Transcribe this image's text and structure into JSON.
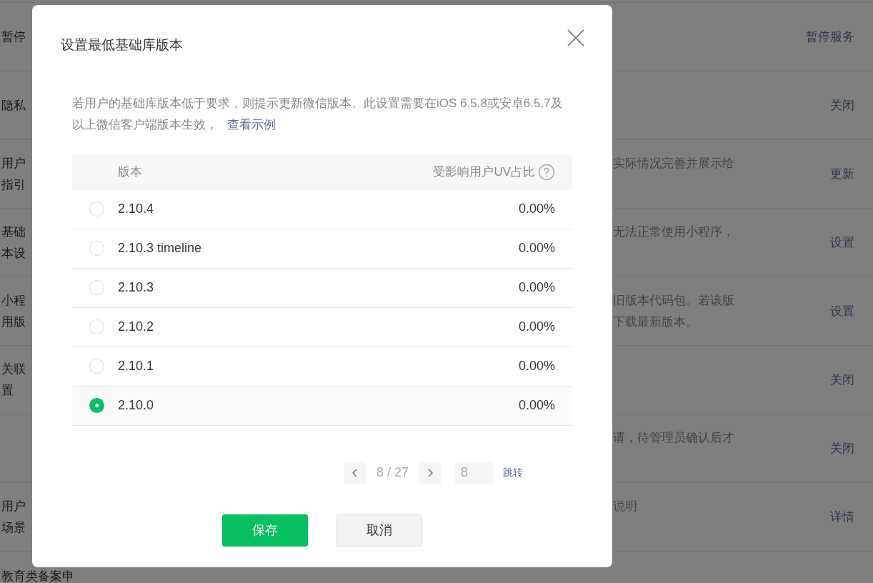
{
  "background_rows": [
    {
      "label": [
        "暂停"
      ],
      "description": [],
      "action": "暂停服务"
    },
    {
      "label": [
        "隐私"
      ],
      "description": [],
      "action": "关闭"
    },
    {
      "label": [
        "用户",
        "指引"
      ],
      "description": [
        "实际情况完善并展示给"
      ],
      "action": "更新"
    },
    {
      "label": [
        "基础",
        "本设"
      ],
      "description": [
        "无法正常使用小程序，"
      ],
      "action": "设置"
    },
    {
      "label": [
        "小程",
        "用版"
      ],
      "description": [
        "旧版本代码包。若该版",
        "下载最新版本。"
      ],
      "action": "设置"
    },
    {
      "label": [
        "关联",
        "置"
      ],
      "description": [],
      "action": "关闭"
    },
    {
      "label": [],
      "description": [
        "请，待管理员确认后才"
      ],
      "action": "关闭"
    },
    {
      "label": [
        "用户",
        "场景"
      ],
      "description": [
        "说明"
      ],
      "action": "详情"
    },
    {
      "label": [
        "教育类备案申"
      ],
      "description": []
    }
  ],
  "dialog": {
    "title": "设置最低基础库版本",
    "notice": "若用户的基础库版本低于要求，则提示更新微信版本。此设置需要在iOS 6.5.8或安卓6.5.7及以上微信客户端版本生效，",
    "notice_link": "查看示例",
    "table": {
      "columns": [
        "版本",
        "受影响用户UV占比"
      ],
      "rows": [
        {
          "version": "2.10.4",
          "share": "0.00%",
          "selected": false
        },
        {
          "version": "2.10.3 timeline",
          "share": "0.00%",
          "selected": false
        },
        {
          "version": "2.10.3",
          "share": "0.00%",
          "selected": false
        },
        {
          "version": "2.10.2",
          "share": "0.00%",
          "selected": false
        },
        {
          "version": "2.10.1",
          "share": "0.00%",
          "selected": false
        },
        {
          "version": "2.10.0",
          "share": "0.00%",
          "selected": true
        }
      ]
    },
    "pagination": {
      "page": "8 / 27",
      "jump_value": "8",
      "jump_label": "跳转"
    },
    "buttons": [
      {
        "label": "保存",
        "kind": "primary"
      },
      {
        "label": "取消",
        "kind": "default"
      }
    ]
  }
}
